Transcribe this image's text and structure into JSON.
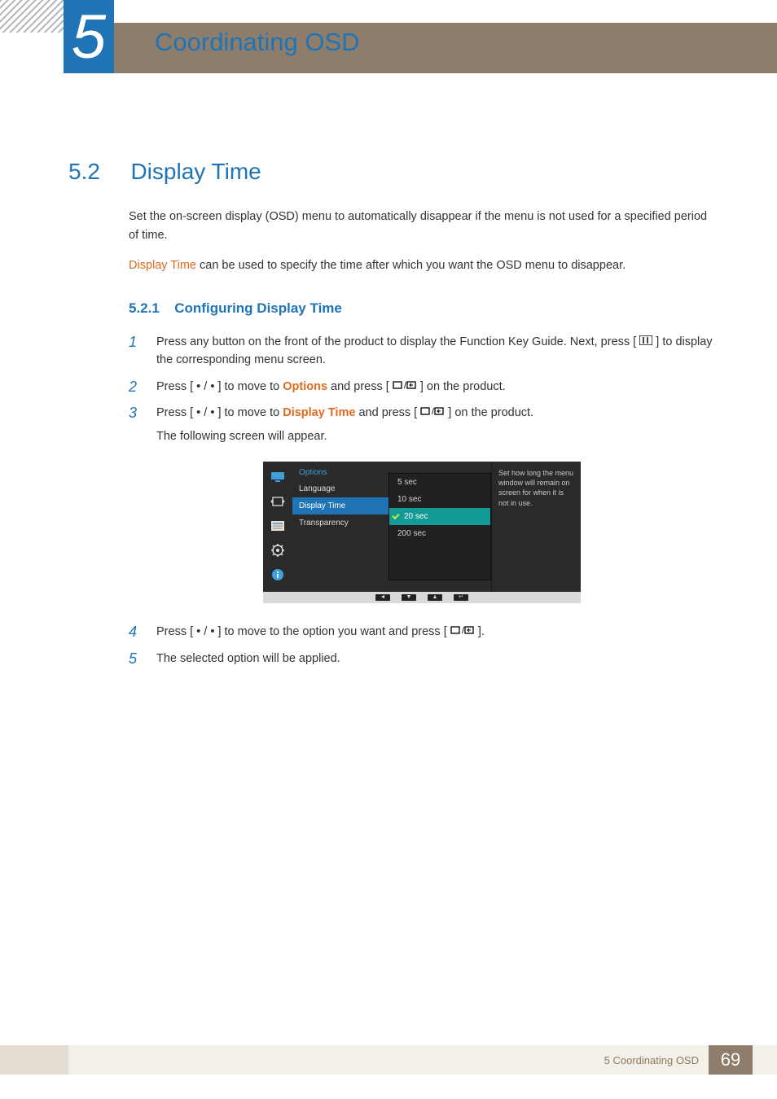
{
  "chapter": {
    "number": "5",
    "title": "Coordinating OSD"
  },
  "section": {
    "number": "5.2",
    "title": "Display Time"
  },
  "intro": {
    "p1": "Set the on-screen display (OSD) menu to automatically disappear if the menu is not used for a specified period of time.",
    "p2a": "Display Time",
    "p2b": " can be used to specify the time after which you want the OSD menu to disappear."
  },
  "subsection": {
    "number": "5.2.1",
    "title": "Configuring Display Time"
  },
  "steps": {
    "s1": "Press any button on the front of the product to display the Function Key Guide. Next, press [",
    "s1b": "] to display the corresponding menu screen.",
    "s2a": "Press [",
    "s2b": "] to move to ",
    "s2c": "Options",
    "s2d": " and press [",
    "s2e": "] on the product.",
    "s3a": "Press [",
    "s3b": "] to move to ",
    "s3c": "Display Time",
    "s3d": " and press [",
    "s3e": "] on the product.",
    "s3f": "The following screen will appear.",
    "s4a": "Press [",
    "s4b": "] to move to the option you want and press [",
    "s4c": "].",
    "s5": "The selected option will be applied."
  },
  "osd": {
    "header": "Options",
    "menu": {
      "language": "Language",
      "displayTime": "Display Time",
      "transparency": "Transparency"
    },
    "opts": {
      "a": "5 sec",
      "b": "10 sec",
      "c": "20 sec",
      "d": "200 sec"
    },
    "help": "Set how long the menu window will remain on screen for when it is not in use."
  },
  "footer": {
    "label": "5 Coordinating OSD",
    "page": "69"
  }
}
